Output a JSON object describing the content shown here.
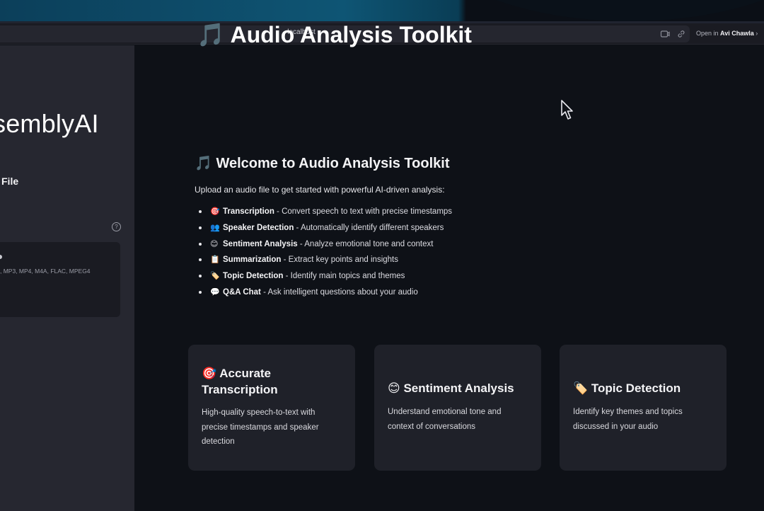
{
  "browser": {
    "url": "localhost",
    "open_in_label": "Open in",
    "open_in_user": "Avi Chawla"
  },
  "sidebar": {
    "logo_text": "semblyAI",
    "upload_heading": "File",
    "dropzone_formats": ", MP3, MP4, M4A, FLAC, MPEG4",
    "help_icon": "question-circle-icon"
  },
  "main": {
    "title": "🎵 Audio Analysis Toolkit",
    "welcome_heading": "🎵 Welcome to Audio Analysis Toolkit",
    "intro": "Upload an audio file to get started with powerful AI-driven analysis:",
    "features": [
      {
        "emoji": "🎯",
        "name": "Transcription",
        "desc": " - Convert speech to text with precise timestamps"
      },
      {
        "emoji": "👥",
        "name": "Speaker Detection",
        "desc": " - Automatically identify different speakers"
      },
      {
        "emoji": "😊",
        "name": "Sentiment Analysis",
        "desc": " - Analyze emotional tone and context"
      },
      {
        "emoji": "📋",
        "name": "Summarization",
        "desc": " - Extract key points and insights"
      },
      {
        "emoji": "🏷️",
        "name": "Topic Detection",
        "desc": " - Identify main topics and themes"
      },
      {
        "emoji": "💬",
        "name": "Q&A Chat",
        "desc": " - Ask intelligent questions about your audio"
      }
    ],
    "cards": [
      {
        "title_line1": "🎯 Accurate",
        "title_line2": "Transcription",
        "body": "High-quality speech-to-text with precise timestamps and speaker detection"
      },
      {
        "title": "😊 Sentiment Analysis",
        "body": "Understand emotional tone and context of conversations"
      },
      {
        "title": "🏷️ Topic Detection",
        "body": "Identify key themes and topics discussed in your audio"
      }
    ]
  },
  "colors": {
    "background": "#0e1117",
    "sidebar": "#262730",
    "card": "#1f2129"
  }
}
